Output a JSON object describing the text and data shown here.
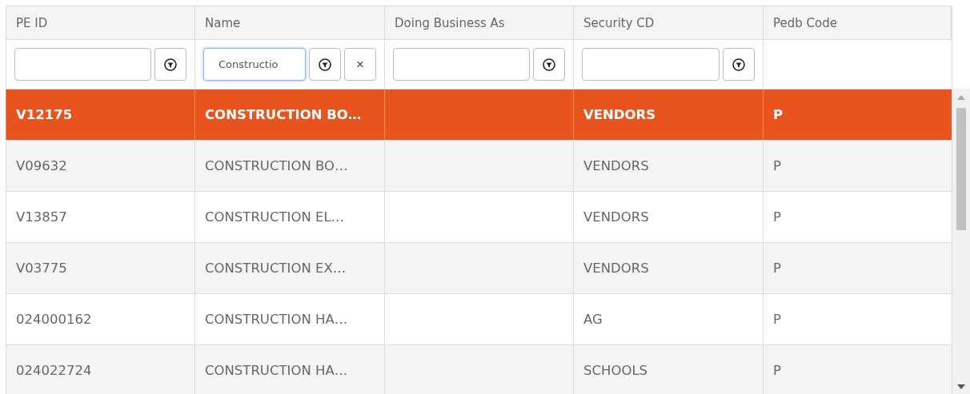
{
  "columns": [
    "PE ID",
    "Name",
    "Doing Business As",
    "Security CD",
    "Pedb Code"
  ],
  "filters": [
    {
      "kind": "filter",
      "focused": false
    },
    {
      "kind": "filter",
      "value": "Constructio",
      "focused": true,
      "clear": "×"
    },
    {
      "kind": "filter",
      "focused": false
    },
    {
      "kind": "filter",
      "focused": false
    },
    {
      "kind": "none"
    }
  ],
  "rows": [
    {
      "selected": true,
      "cells": [
        "V12175",
        "CONSTRUCTION BO…",
        null,
        "VENDORS",
        "P"
      ]
    },
    {
      "selected": false,
      "cells": [
        "V09632",
        "CONSTRUCTION BO…",
        null,
        "VENDORS",
        "P"
      ]
    },
    {
      "selected": false,
      "cells": [
        "V13857",
        "CONSTRUCTION EL…",
        null,
        "VENDORS",
        "P"
      ]
    },
    {
      "selected": false,
      "cells": [
        "V03775",
        "CONSTRUCTION EX…",
        null,
        "VENDORS",
        "P"
      ]
    },
    {
      "selected": false,
      "cells": [
        "024000162",
        "CONSTRUCTION HA…",
        null,
        "AG",
        "P"
      ]
    },
    {
      "selected": false,
      "cells": [
        "024022724",
        "CONSTRUCTION HA…",
        null,
        "SCHOOLS",
        "P"
      ]
    }
  ]
}
